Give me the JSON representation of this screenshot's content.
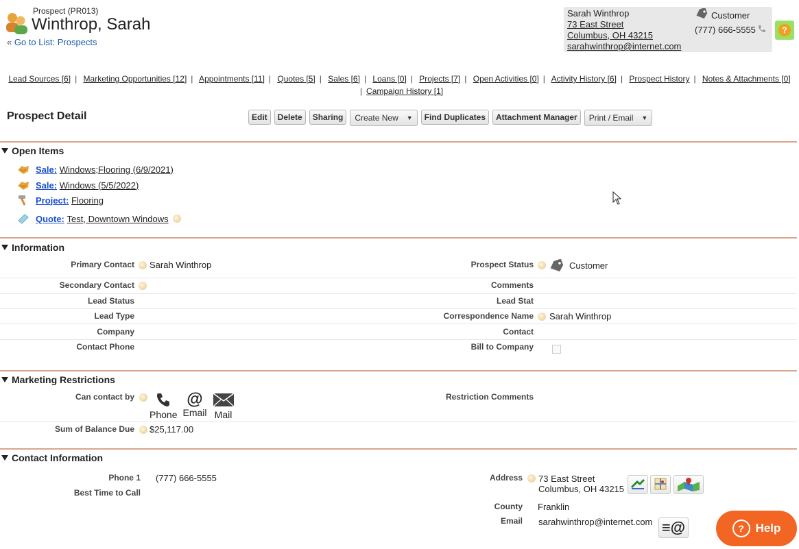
{
  "header": {
    "subtitle": "Prospect (PR013)",
    "title": "Winthrop, Sarah",
    "back_prefix": "«",
    "back_link": "Go to List: Prospects"
  },
  "contact_card": {
    "name": "Sarah Winthrop",
    "street": "73 East Street",
    "city": "Columbus, OH 43215",
    "email": "sarahwinthrop@internet.com",
    "status": "Customer",
    "phone": "(777) 666-5555"
  },
  "related_links": [
    "Lead Sources [6]",
    "Marketing Opportunities [12]",
    "Appointments [11]",
    "Quotes [5]",
    "Sales [6]",
    "Loans [0]",
    "Projects [7]",
    "Open Activities [0]",
    "Activity History [6]",
    "Prospect History",
    "Notes & Attachments [0]",
    "Campaign History [1]"
  ],
  "detail": {
    "title": "Prospect Detail",
    "buttons": {
      "edit": "Edit",
      "delete": "Delete",
      "sharing": "Sharing",
      "create_new": "Create New",
      "find_duplicates": "Find Duplicates",
      "attachment_manager": "Attachment Manager",
      "print_email": "Print / Email"
    }
  },
  "open_items": {
    "title": "Open Items",
    "items": [
      {
        "kind": "Sale:",
        "text": "Windows;Flooring (6/9/2021)"
      },
      {
        "kind": "Sale:",
        "text": "Windows (5/5/2022)"
      },
      {
        "kind": "Project:",
        "text": "Flooring"
      },
      {
        "kind": "Quote:",
        "text": "Test, Downtown Windows"
      }
    ]
  },
  "information": {
    "title": "Information",
    "primary_contact_label": "Primary Contact",
    "primary_contact": "Sarah Winthrop",
    "secondary_contact_label": "Secondary Contact",
    "lead_status_label": "Lead Status",
    "lead_type_label": "Lead Type",
    "company_label": "Company",
    "contact_phone_label": "Contact Phone",
    "prospect_status_label": "Prospect Status",
    "prospect_status": "Customer",
    "comments_label": "Comments",
    "lead_stat_label": "Lead Stat",
    "correspondence_label": "Correspondence Name",
    "correspondence": "Sarah Winthrop",
    "contact_label": "Contact",
    "bill_to_label": "Bill to Company"
  },
  "marketing": {
    "title": "Marketing Restrictions",
    "can_contact_label": "Can contact by",
    "phone": "Phone",
    "email": "Email",
    "mail": "Mail",
    "restriction_label": "Restriction Comments",
    "sum_balance_label": "Sum of Balance Due",
    "sum_balance": "$25,117.00"
  },
  "contact_info": {
    "title": "Contact Information",
    "phone1_label": "Phone 1",
    "phone1": "(777) 666-5555",
    "best_time_label": "Best Time to Call",
    "address_label": "Address",
    "address_line1": "73 East Street",
    "address_line2": "Columbus, OH 43215",
    "county_label": "County",
    "county": "Franklin",
    "email_label": "Email",
    "email": "sarahwinthrop@internet.com"
  },
  "help_button": "Help",
  "colors": {
    "section_rule": "#d8a58a",
    "link_blue": "#1a4fd0",
    "help_orange": "#f26522",
    "help_green": "#9be060"
  }
}
